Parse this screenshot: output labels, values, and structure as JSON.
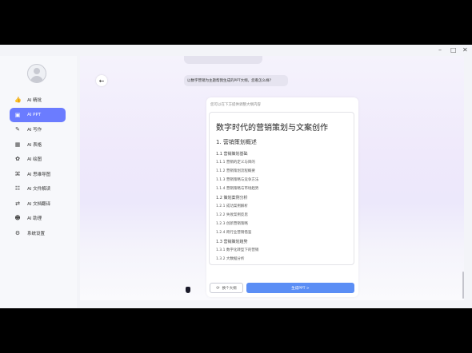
{
  "window": {
    "controls": {
      "minimize": "–",
      "maximize": "□",
      "close": "✕"
    }
  },
  "sidebar": {
    "items": [
      {
        "label": "AI 精批",
        "icon": "thumb-up-icon",
        "glyph": "👍",
        "active": false
      },
      {
        "label": "AI PPT",
        "icon": "presentation-icon",
        "glyph": "▣",
        "active": true
      },
      {
        "label": "AI 写作",
        "icon": "pen-icon",
        "glyph": "✎",
        "active": false
      },
      {
        "label": "AI 表格",
        "icon": "table-icon",
        "glyph": "▦",
        "active": false
      },
      {
        "label": "AI 绘图",
        "icon": "paint-icon",
        "glyph": "✿",
        "active": false
      },
      {
        "label": "AI 思维导图",
        "icon": "mindmap-icon",
        "glyph": "⌘",
        "active": false
      },
      {
        "label": "AI 文件解读",
        "icon": "file-read-icon",
        "glyph": "☷",
        "active": false
      },
      {
        "label": "AI 文档翻译",
        "icon": "translate-icon",
        "glyph": "⇄",
        "active": false
      },
      {
        "label": "AI 助理",
        "icon": "robot-icon",
        "glyph": "☻",
        "active": false
      },
      {
        "label": "系统设置",
        "icon": "gear-icon",
        "glyph": "⚙",
        "active": false
      }
    ]
  },
  "chat": {
    "user_message": "以数字营销为主题帮我生成的PPT大纲，您看怎么样?"
  },
  "outline_card": {
    "hint": "您可以在下方提供调整大纲内容",
    "title": "数字时代的营销策划与文案创作",
    "chapter1": "1. 营销策划概述",
    "items": [
      {
        "level": 2,
        "text": "1.1 营销策划基础"
      },
      {
        "level": 3,
        "text": "1.1.1 营销的定义与目的"
      },
      {
        "level": 3,
        "text": "1.1.2 营销策划流程概要"
      },
      {
        "level": 3,
        "text": "1.1.3 营销策略与竞争方法"
      },
      {
        "level": 3,
        "text": "1.1.4 营销策略与市场趋势"
      },
      {
        "level": 2,
        "text": "1.2 策划案例分析"
      },
      {
        "level": 3,
        "text": "1.2.1 成功案例解析"
      },
      {
        "level": 3,
        "text": "1.2.2 失败案例反思"
      },
      {
        "level": 3,
        "text": "1.2.3 创新营销策略"
      },
      {
        "level": 3,
        "text": "1.2.4 跨行业营销借鉴"
      },
      {
        "level": 2,
        "text": "1.3 营销策划趋势"
      },
      {
        "level": 3,
        "text": "1.3.1 数字化转型下的营销"
      },
      {
        "level": 3,
        "text": "1.3.2 大数据分析"
      }
    ],
    "rewrite_label": "换个大纲",
    "generate_label": "生成PPT  >"
  },
  "colors": {
    "accent": "#6b7cff",
    "button": "#5b8ef5"
  }
}
